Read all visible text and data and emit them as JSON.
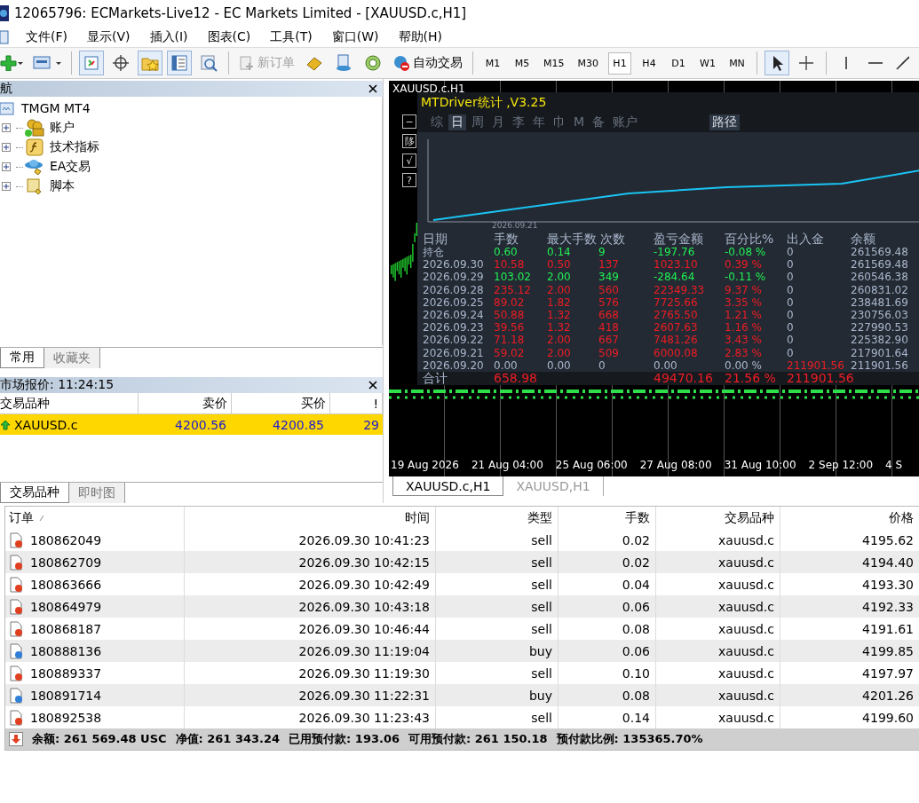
{
  "window": {
    "title": "12065796: ECMarkets-Live12 - EC Markets Limited - [XAUUSD.c,H1]"
  },
  "menu": [
    "文件(F)",
    "显示(V)",
    "插入(I)",
    "图表(C)",
    "工具(T)",
    "窗口(W)",
    "帮助(H)"
  ],
  "toolbar": {
    "new_order": {
      "label": "新订单",
      "disabled": true
    },
    "auto_trading": {
      "label": "自动交易"
    },
    "timeframes": [
      {
        "label": "M1",
        "selected": false
      },
      {
        "label": "M5",
        "selected": false
      },
      {
        "label": "M15",
        "selected": false
      },
      {
        "label": "M30",
        "selected": false
      },
      {
        "label": "H1",
        "selected": true
      },
      {
        "label": "H4",
        "selected": false
      },
      {
        "label": "D1",
        "selected": false
      },
      {
        "label": "W1",
        "selected": false
      },
      {
        "label": "MN",
        "selected": false
      }
    ]
  },
  "navigator": {
    "title": "航",
    "root": "TMGM MT4",
    "items": [
      {
        "label": "账户",
        "kind": "accounts",
        "expanded": false
      },
      {
        "label": "技术指标",
        "kind": "indicators",
        "expanded": false
      },
      {
        "label": "EA交易",
        "kind": "experts",
        "expanded": false
      },
      {
        "label": "脚本",
        "kind": "scripts",
        "expanded": false
      }
    ],
    "tabs": [
      {
        "label": "常用",
        "selected": true
      },
      {
        "label": "收藏夹",
        "selected": false
      }
    ]
  },
  "market_watch": {
    "title": "市场报价: 11:24:15",
    "columns": [
      "交易品种",
      "卖价",
      "买价",
      "!"
    ],
    "rows": [
      {
        "symbol": "XAUUSD.c",
        "bid": "4200.56",
        "ask": "4200.85",
        "spread": "29",
        "selected": true
      }
    ],
    "tabs": [
      {
        "label": "交易品种",
        "selected": true
      },
      {
        "label": "即时图",
        "selected": false
      }
    ]
  },
  "chart": {
    "title": "XAUUSD.c,H1",
    "x_labels": [
      "19 Aug 2026",
      "21 Aug 04:00",
      "25 Aug 06:00",
      "27 Aug 08:00",
      "31 Aug 10:00",
      "2 Sep 12:00",
      "4 S"
    ],
    "side_buttons": [
      "−",
      "陊",
      "√",
      "?"
    ],
    "tabs": [
      {
        "label": "XAUUSD.c,H1",
        "selected": true
      },
      {
        "label": "XAUUSD,H1",
        "selected": false
      }
    ]
  },
  "stats_panel": {
    "title": "MTDriver统计 ,V3.25",
    "tabs": [
      {
        "label": "综",
        "selected": false
      },
      {
        "label": "日",
        "selected": true
      },
      {
        "label": "周",
        "selected": false
      },
      {
        "label": "月",
        "selected": false
      },
      {
        "label": "李",
        "selected": false
      },
      {
        "label": "年",
        "selected": false
      },
      {
        "label": "巾",
        "selected": false
      },
      {
        "label": "M",
        "selected": false
      },
      {
        "label": "备",
        "selected": false
      },
      {
        "label": "账户",
        "selected": false
      }
    ],
    "path_button": "路径",
    "equity_date": "2026.09.21",
    "columns": [
      "日期",
      "手数",
      "最大手数",
      "次数",
      "盈亏金额",
      "百分比%",
      "出入金",
      "余额"
    ],
    "rows": [
      {
        "cells": [
          "持仓",
          "0.60",
          "0.14",
          "9",
          "-197.76",
          "-0.08 %",
          "0",
          "261569.48"
        ],
        "color": "#22ee55",
        "deposit_flag": false
      },
      {
        "cells": [
          "2026.09.30",
          "10.58",
          "0.50",
          "137",
          "1023.10",
          "0.39 %",
          "0",
          "261569.48"
        ],
        "color": "#ee1c24",
        "deposit_flag": false
      },
      {
        "cells": [
          "2026.09.29",
          "103.02",
          "2.00",
          "349",
          "-284.64",
          "-0.11 %",
          "0",
          "260546.38"
        ],
        "color": "#22ee55",
        "deposit_flag": false
      },
      {
        "cells": [
          "2026.09.28",
          "235.12",
          "2.00",
          "560",
          "22349.33",
          "9.37 %",
          "0",
          "260831.02"
        ],
        "color": "#ee1c24",
        "deposit_flag": false
      },
      {
        "cells": [
          "2026.09.25",
          "89.02",
          "1.82",
          "576",
          "7725.66",
          "3.35 %",
          "0",
          "238481.69"
        ],
        "color": "#ee1c24",
        "deposit_flag": false
      },
      {
        "cells": [
          "2026.09.24",
          "50.88",
          "1.32",
          "668",
          "2765.50",
          "1.21 %",
          "0",
          "230756.03"
        ],
        "color": "#ee1c24",
        "deposit_flag": false
      },
      {
        "cells": [
          "2026.09.23",
          "39.56",
          "1.32",
          "418",
          "2607.63",
          "1.16 %",
          "0",
          "227990.53"
        ],
        "color": "#ee1c24",
        "deposit_flag": false
      },
      {
        "cells": [
          "2026.09.22",
          "71.18",
          "2.00",
          "667",
          "7481.26",
          "3.43 %",
          "0",
          "225382.90"
        ],
        "color": "#ee1c24",
        "deposit_flag": false
      },
      {
        "cells": [
          "2026.09.21",
          "59.02",
          "2.00",
          "509",
          "6000.08",
          "2.83 %",
          "0",
          "217901.64"
        ],
        "color": "#ee1c24",
        "deposit_flag": false
      },
      {
        "cells": [
          "2026.09.20",
          "0.00",
          "0.00",
          "0",
          "0.00",
          "0.00 %",
          "211901.56",
          "211901.56"
        ],
        "color": "#a9b6cc",
        "deposit_flag": true
      }
    ],
    "total": {
      "label": "合计",
      "lots": "658.98",
      "pnl": "49470.16",
      "percent": "21.56 %",
      "deposit": "211901.56"
    }
  },
  "orders": {
    "columns": [
      "订单",
      "时间",
      "类型",
      "手数",
      "交易品种",
      "价格"
    ],
    "rows": [
      {
        "id": "180862049",
        "time": "2026.09.30 10:41:23",
        "type": "sell",
        "lots": "0.02",
        "symbol": "xauusd.c",
        "price": "4195.62",
        "kind": "sell"
      },
      {
        "id": "180862709",
        "time": "2026.09.30 10:42:15",
        "type": "sell",
        "lots": "0.02",
        "symbol": "xauusd.c",
        "price": "4194.40",
        "kind": "sell"
      },
      {
        "id": "180863666",
        "time": "2026.09.30 10:42:49",
        "type": "sell",
        "lots": "0.04",
        "symbol": "xauusd.c",
        "price": "4193.30",
        "kind": "sell"
      },
      {
        "id": "180864979",
        "time": "2026.09.30 10:43:18",
        "type": "sell",
        "lots": "0.06",
        "symbol": "xauusd.c",
        "price": "4192.33",
        "kind": "sell"
      },
      {
        "id": "180868187",
        "time": "2026.09.30 10:46:44",
        "type": "sell",
        "lots": "0.08",
        "symbol": "xauusd.c",
        "price": "4191.61",
        "kind": "sell"
      },
      {
        "id": "180888136",
        "time": "2026.09.30 11:19:04",
        "type": "buy",
        "lots": "0.06",
        "symbol": "xauusd.c",
        "price": "4199.85",
        "kind": "buy"
      },
      {
        "id": "180889337",
        "time": "2026.09.30 11:19:30",
        "type": "sell",
        "lots": "0.10",
        "symbol": "xauusd.c",
        "price": "4197.97",
        "kind": "sell"
      },
      {
        "id": "180891714",
        "time": "2026.09.30 11:22:31",
        "type": "buy",
        "lots": "0.08",
        "symbol": "xauusd.c",
        "price": "4201.26",
        "kind": "buy"
      },
      {
        "id": "180892538",
        "time": "2026.09.30 11:23:43",
        "type": "sell",
        "lots": "0.14",
        "symbol": "xauusd.c",
        "price": "4199.60",
        "kind": "sell"
      }
    ],
    "summary": [
      "余额: 261 569.48 USC",
      "净值: 261 343.24",
      "已用预付款: 193.06",
      "可用预付款: 261 150.18",
      "预付款比例: 135365.70%"
    ]
  }
}
